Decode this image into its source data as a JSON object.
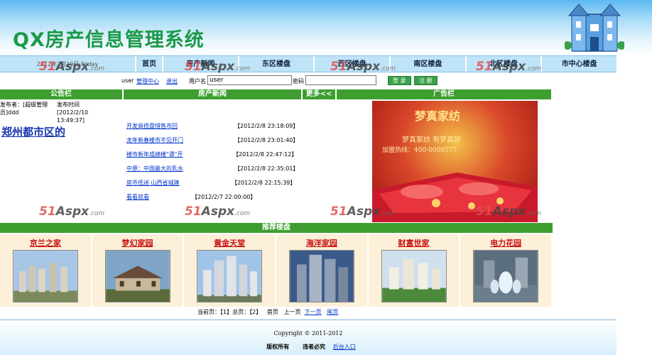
{
  "header": {
    "title": "QX房产信息管理系统"
  },
  "nav": {
    "date": "2012年2月10日 Friday",
    "items": [
      "首页",
      "房产新闻",
      "东区楼盘",
      "西区楼盘",
      "南区楼盘",
      "北区楼盘",
      "市中心楼盘"
    ]
  },
  "watermark": {
    "brand": "51",
    "aspx": "Aspx",
    "domain": ".com"
  },
  "login": {
    "user_label": "user",
    "admin_link": "管理中心",
    "logout_link": "退出",
    "username_label": "用户名",
    "username_value": "user",
    "password_label": "密码",
    "login_button": "登 录",
    "register_button": "注 册"
  },
  "sections": {
    "notice": "公告栏",
    "news": "房产新闻",
    "more": "更多<<",
    "ads": "广告栏",
    "featured": "推荐楼盘"
  },
  "notice": {
    "publisher": "发布者：[超级管理员]ddd",
    "time": "发布时间[2012/2/10 13:49:37]",
    "title": "郑州都市区的"
  },
  "news": [
    {
      "title": "开发商捂盘惜售市回",
      "date": "【2012/2/8 23:18:09】"
    },
    {
      "title": "龙年新春楼市不见开门",
      "date": "【2012/2/8 23:01:40】"
    },
    {
      "title": "楼市新年成绩楼\"谭\"开",
      "date": "【2012/2/8 22:47:12】"
    },
    {
      "title": "中原：中国最大的乳水",
      "date": "【2012/2/8 22:35:01】"
    },
    {
      "title": "房市低迷 山西省城建",
      "date": "【2012/2/8 22:15:39】"
    },
    {
      "title": "看看就看",
      "date": "【2012/2/7 22:00:00】"
    }
  ],
  "ad": {
    "brand": "梦真家纺",
    "slogan": "梦真家纺  有梦真好",
    "hotline": "加盟热线：400-0008577"
  },
  "featured": [
    "京兰之家",
    "梦幻家园",
    "黄金天堂",
    "海洋家园",
    "财富世家",
    "电力花园"
  ],
  "pager": {
    "current_label": "当前页：【",
    "current": "1",
    "total_label": "】总页：【",
    "total": "2",
    "end": "】",
    "first": "首页",
    "prev": "上一页",
    "next": "下一页",
    "last": "尾页"
  },
  "footer": {
    "copyright": "Copyright © 2011-2012",
    "rights": "版权所有",
    "violation": "违者必究",
    "backend": "后台入口"
  },
  "colors": {
    "green": "#3d9e2f",
    "blue_link": "#0033cc",
    "title": "#1a9a4a"
  }
}
